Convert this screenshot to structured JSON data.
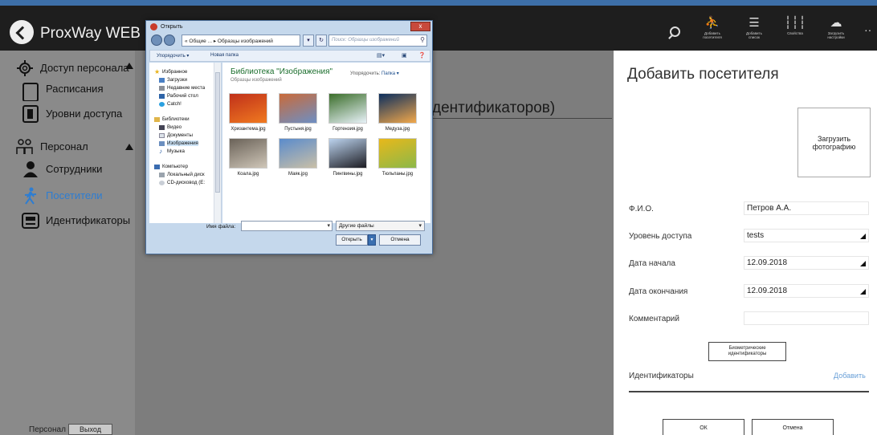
{
  "header": {
    "app_title": "ProxWay WEB",
    "actions": [
      {
        "icon": "add-visitor-icon",
        "label": "Добавить посетителя"
      },
      {
        "icon": "add-list-icon",
        "label": "Добавить список"
      },
      {
        "icon": "properties-icon",
        "label": "Свойства"
      },
      {
        "icon": "upload-settings-icon",
        "label": "Загрузить настройки"
      }
    ],
    "more": "··"
  },
  "sidebar": {
    "group_access": "Доступ персонала",
    "item_schedules": "Расписания",
    "item_access_levels": "Уровни доступа",
    "group_staff": "Персонал",
    "item_employees": "Сотрудники",
    "item_visitors": "Посетители",
    "item_identifiers": "Идентификаторы",
    "footer_user": "Персонал",
    "footer_exit": "Выход"
  },
  "background": {
    "title_partial": "дентификаторов)"
  },
  "panel": {
    "title": "Добавить посетителя",
    "photo_button": "Загрузить фотографию",
    "fields": {
      "fio_label": "Ф.И.О.",
      "fio_value": "Петров А.А.",
      "level_label": "Уровень доступа",
      "level_value": "tests",
      "start_label": "Дата начала",
      "start_value": "12.09.2018",
      "end_label": "Дата окончания",
      "end_value": "12.09.2018",
      "comment_label": "Комментарий",
      "comment_value": ""
    },
    "biometric_button": "Биометрические идентификаторы",
    "identifiers_label": "Идентификаторы",
    "add_link": "Добавить",
    "ok_button": "ОК",
    "cancel_button": "Отмена"
  },
  "dialog": {
    "title": "Открыть",
    "close": "x",
    "address": "« Общие ... ▸ Образцы изображений",
    "search_placeholder": "Поиск: Образцы изображений",
    "toolbar": {
      "organize": "Упорядочить ▾",
      "new_folder": "Новая папка"
    },
    "nav": {
      "favorites": "Избранное",
      "downloads": "Загрузки",
      "recent": "Недавние места",
      "desktop": "Рабочий стол",
      "catch": "Catch!",
      "libraries": "Библиотеки",
      "video": "Видео",
      "documents": "Документы",
      "images": "Изображения",
      "music": "Музыка",
      "computer": "Компьютер",
      "local_disk": "Локальный диск",
      "cd_drive": "CD-дисковод (E:"
    },
    "library_title": "Библиотека \"Изображения\"",
    "library_sub": "Образцы изображений",
    "sort_label": "Упорядочить:",
    "sort_value": "Папка ▾",
    "files": [
      {
        "name": "Хризантема.jpg",
        "color_a": "#c0301a",
        "color_b": "#f07a20"
      },
      {
        "name": "Пустыня.jpg",
        "color_a": "#c96a3a",
        "color_b": "#6d8fc4"
      },
      {
        "name": "Гортензия.jpg",
        "color_a": "#3b6e2a",
        "color_b": "#e8f2f8"
      },
      {
        "name": "Медуза.jpg",
        "color_a": "#0b2e5e",
        "color_b": "#f2a84a"
      },
      {
        "name": "Коала.jpg",
        "color_a": "#6a6258",
        "color_b": "#cfc6b8"
      },
      {
        "name": "Маяк.jpg",
        "color_a": "#5a8bcc",
        "color_b": "#c9bfa7"
      },
      {
        "name": "Пингвины.jpg",
        "color_a": "#bcd3ee",
        "color_b": "#1c1c22"
      },
      {
        "name": "Тюльпаны.jpg",
        "color_a": "#e8b81a",
        "color_b": "#8bb84a"
      }
    ],
    "file_name_label": "Имя файла:",
    "file_name_value": "",
    "file_type": "Другие файлы",
    "open_button": "Открыть",
    "cancel_button": "Отмена"
  }
}
